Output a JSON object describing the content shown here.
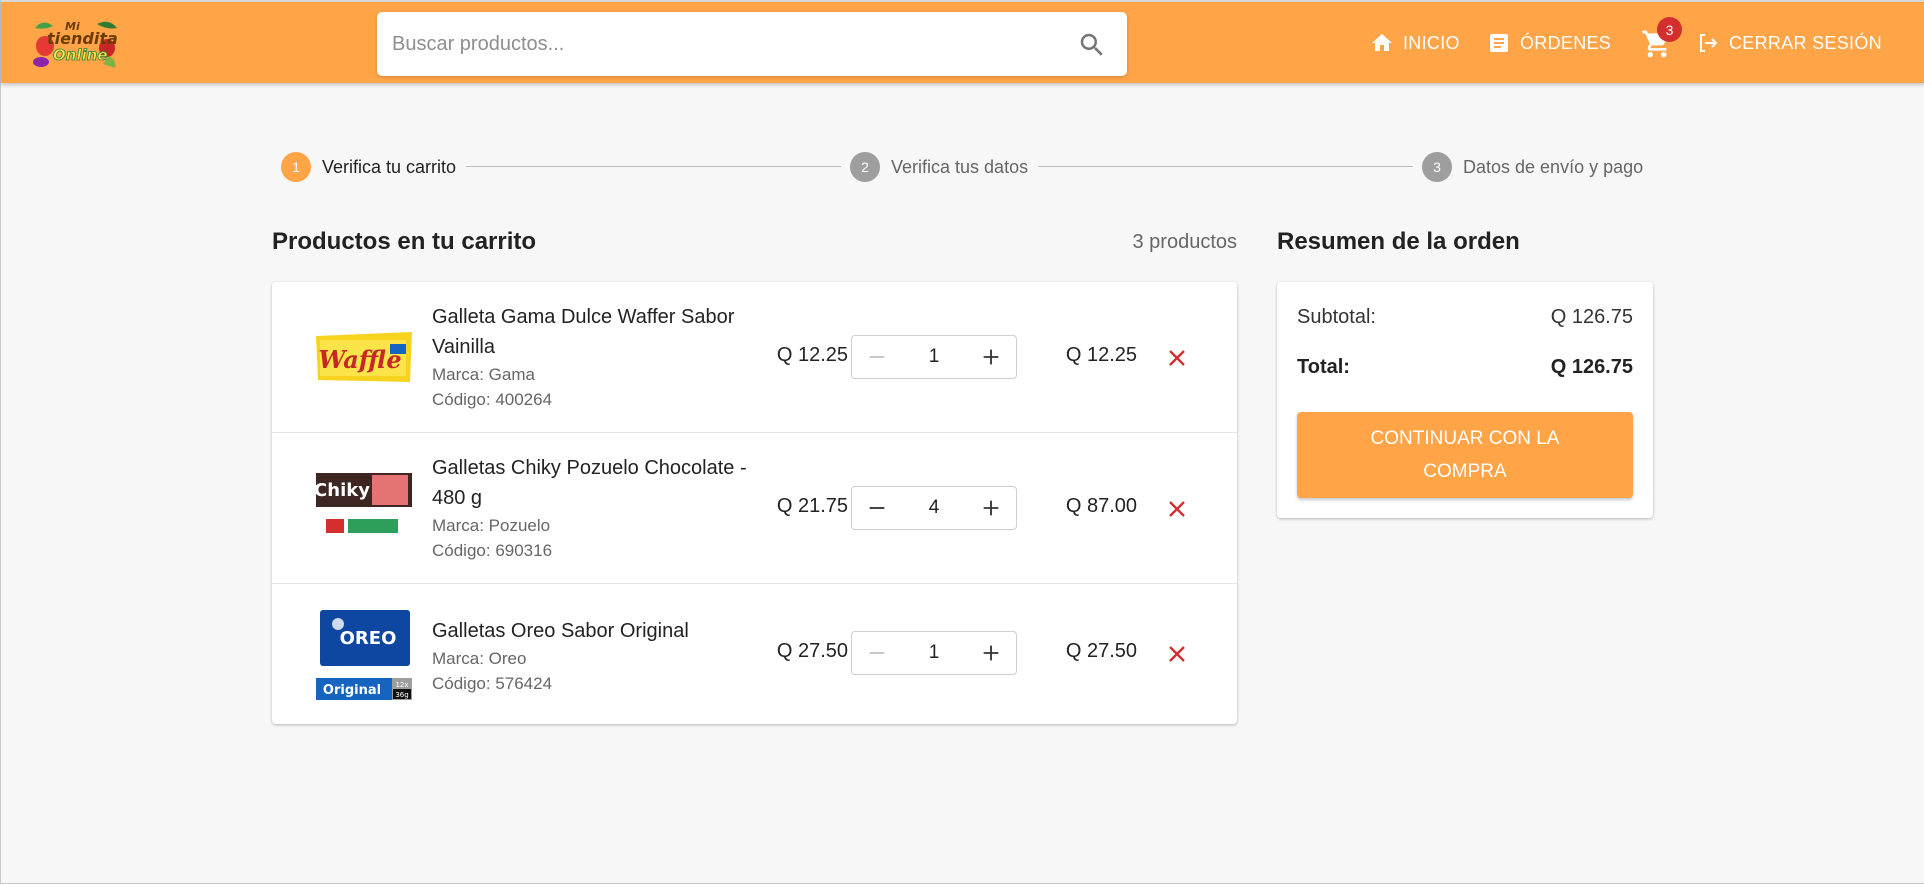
{
  "brand": {
    "logo_line1": "Mi",
    "logo_line2": "tiendita",
    "logo_line3": "Online"
  },
  "search": {
    "placeholder": "Buscar productos..."
  },
  "nav": {
    "home_label": "INICIO",
    "orders_label": "ÓRDENES",
    "cart_count": "3",
    "logout_label": "CERRAR SESIÓN"
  },
  "stepper": {
    "steps": [
      {
        "number": "1",
        "label": "Verifica tu carrito",
        "state": "active"
      },
      {
        "number": "2",
        "label": "Verifica tus datos",
        "state": "inactive"
      },
      {
        "number": "3",
        "label": "Datos de envío y pago",
        "state": "inactive"
      }
    ]
  },
  "cart": {
    "title": "Productos en tu carrito",
    "count_label": "3 productos",
    "items": [
      {
        "name": "Galleta Gama Dulce Waffer Sabor Vainilla",
        "brand": "Marca: Gama",
        "code": "Código: 400264",
        "unit_price": "Q 12.25",
        "quantity": "1",
        "line_total": "Q 12.25",
        "image_text": "Waffle"
      },
      {
        "name": "Galletas Chiky Pozuelo Chocolate - 480 g",
        "brand": "Marca: Pozuelo",
        "code": "Código: 690316",
        "unit_price": "Q 21.75",
        "quantity": "4",
        "line_total": "Q 87.00",
        "image_text": "Chiky"
      },
      {
        "name": "Galletas Oreo Sabor Original",
        "brand": "Marca: Oreo",
        "code": "Código: 576424",
        "unit_price": "Q 27.50",
        "quantity": "1",
        "line_total": "Q 27.50",
        "image_text": "OREO",
        "image_sub": "Original",
        "image_pack_count": "12x",
        "image_pack_weight": "36g"
      }
    ]
  },
  "summary": {
    "title": "Resumen de la orden",
    "subtotal_label": "Subtotal:",
    "subtotal_value": "Q 126.75",
    "total_label": "Total:",
    "total_value": "Q 126.75",
    "checkout_label": "CONTINUAR CON LA COMPRA"
  },
  "colors": {
    "primary": "#ffa447",
    "badge": "#d32f2f",
    "remove": "#d32f2f",
    "step_inactive": "#9e9e9e"
  }
}
